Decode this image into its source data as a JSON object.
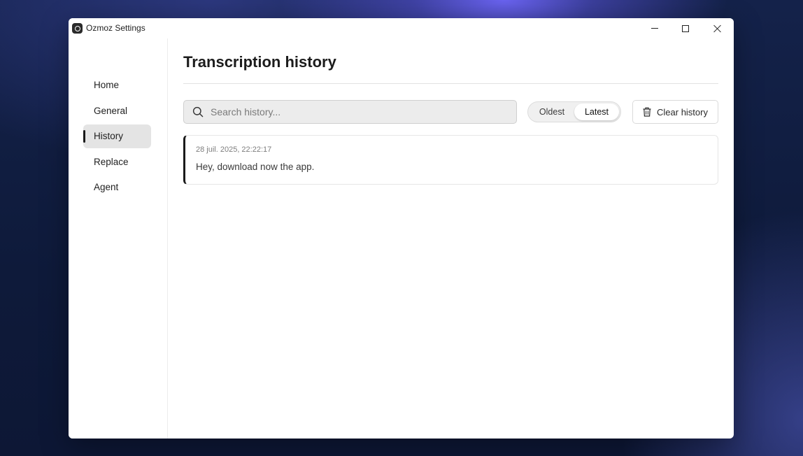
{
  "window": {
    "title": "Ozmoz Settings",
    "controls": {
      "minimize_icon": "minimize-icon",
      "maximize_icon": "maximize-icon",
      "close_icon": "close-icon"
    }
  },
  "sidebar": {
    "items": [
      {
        "label": "Home",
        "active": false
      },
      {
        "label": "General",
        "active": false
      },
      {
        "label": "History",
        "active": true
      },
      {
        "label": "Replace",
        "active": false
      },
      {
        "label": "Agent",
        "active": false
      }
    ]
  },
  "main": {
    "title": "Transcription history",
    "search": {
      "placeholder": "Search history...",
      "value": "",
      "icon": "search-icon"
    },
    "sort": {
      "options": [
        "Oldest",
        "Latest"
      ],
      "selected": "Latest"
    },
    "clear_button": {
      "label": "Clear history",
      "icon": "trash-icon"
    },
    "entries": [
      {
        "timestamp": "28 juil. 2025, 22:22:17",
        "text": "Hey, download now the app."
      }
    ]
  },
  "colors": {
    "accent": "#1a1a1a",
    "active_nav_bg": "#e4e4e4",
    "search_bg": "#ececec"
  }
}
